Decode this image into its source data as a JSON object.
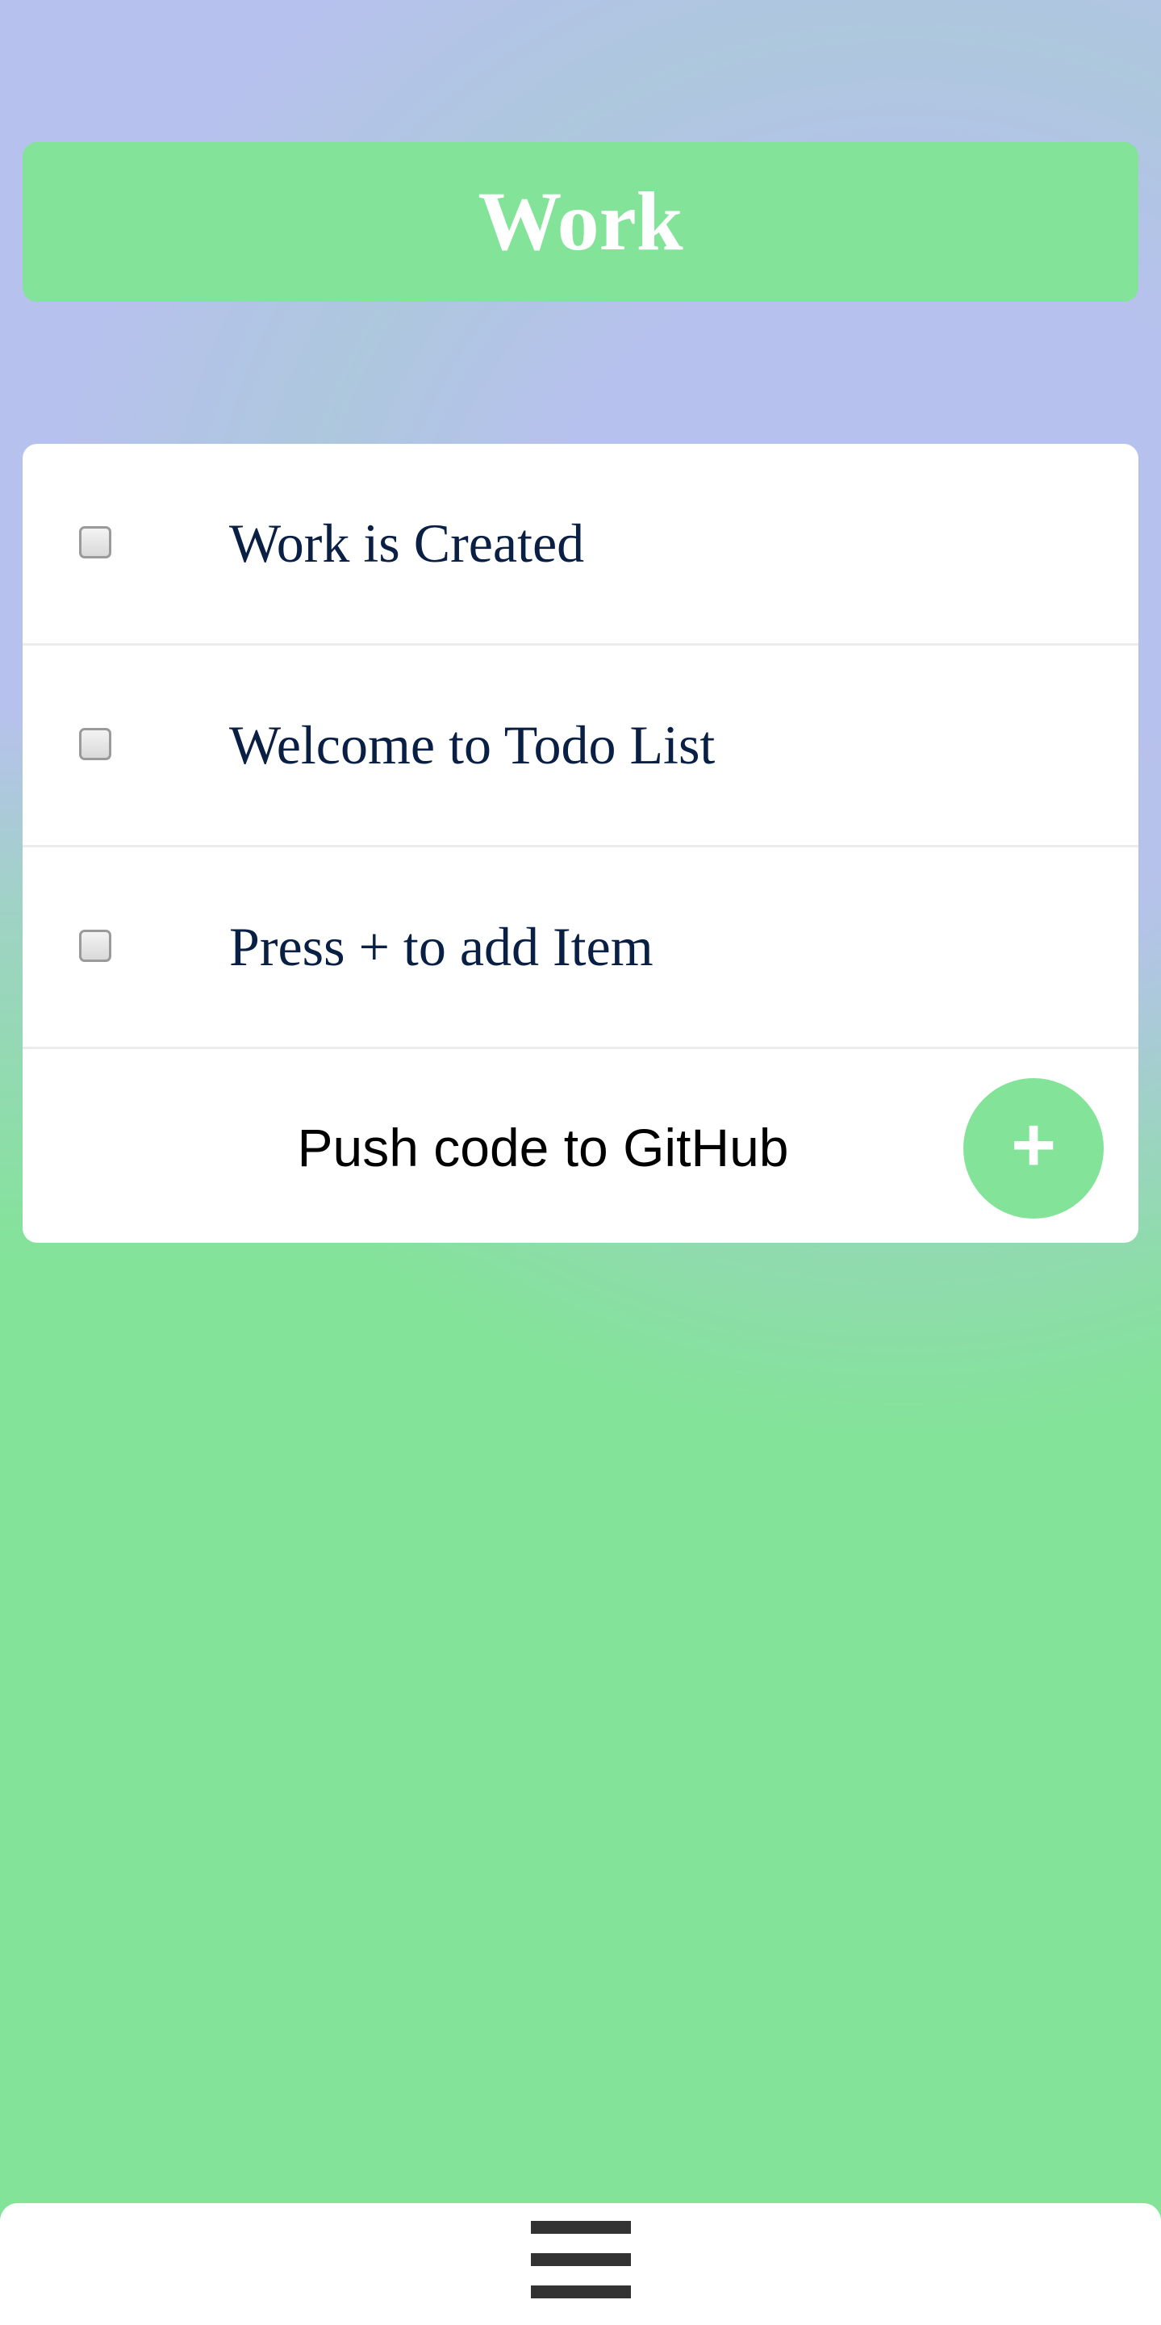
{
  "header": {
    "title": "Work"
  },
  "todo_list": {
    "items": [
      {
        "label": "Work is Created",
        "checked": false
      },
      {
        "label": "Welcome to Todo List",
        "checked": false
      },
      {
        "label": "Press + to add Item",
        "checked": false
      }
    ],
    "new_item": {
      "value": "Push code to GitHub",
      "add_button_label": "+"
    }
  },
  "footer": {
    "menu_icon": "hamburger-menu-icon"
  },
  "colors": {
    "accent_green": "#83e399",
    "background_lavender": "#b7c1ed",
    "item_text": "#0a1f44",
    "card": "#ffffff",
    "menu_icon": "#333333"
  }
}
